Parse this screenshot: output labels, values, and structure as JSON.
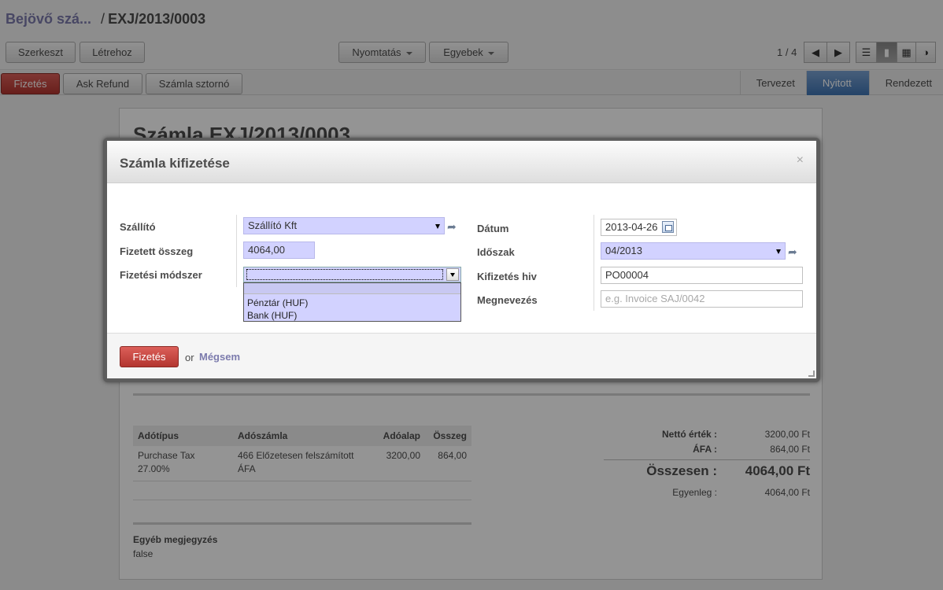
{
  "breadcrumb": {
    "parent": "Bejövő szá...",
    "separator": "/",
    "current": "EXJ/2013/0003"
  },
  "toolbar": {
    "edit": "Szerkeszt",
    "create": "Létrehoz",
    "print": "Nyomtatás",
    "more": "Egyebek"
  },
  "pager": {
    "text": "1 / 4",
    "prev_icon": "arrow-left-icon",
    "next_icon": "arrow-right-icon"
  },
  "view_switcher": {
    "icons": [
      "list-view-icon",
      "form-view-icon",
      "calendar-view-icon",
      "graph-view-icon"
    ],
    "active": "form-view-icon"
  },
  "actions": {
    "pay": "Fizetés",
    "refund": "Ask Refund",
    "cancel_invoice": "Számla sztornó"
  },
  "stages": [
    "Tervezet",
    "Nyitott",
    "Rendezett"
  ],
  "stage_active": "Nyitott",
  "sheet": {
    "title": "Számla EXJ/2013/0003",
    "tax_table": {
      "headers": [
        "Adótípus",
        "Adószámla",
        "Adóalap",
        "Összeg"
      ],
      "rows": [
        [
          "Purchase Tax 27.00%",
          "466 Előzetesen felszámított ÁFA",
          "3200,00",
          "864,00"
        ]
      ]
    },
    "notes_label": "Egyéb megjegyzés",
    "notes_value": "false",
    "totals": {
      "net_label": "Nettó érték :",
      "net_value": "3200,00 Ft",
      "vat_label": "ÁFA :",
      "vat_value": "864,00 Ft",
      "total_label": "Összesen :",
      "total_value": "4064,00 Ft",
      "balance_label": "Egyenleg :",
      "balance_value": "4064,00 Ft"
    }
  },
  "modal": {
    "title": "Számla kifizetése",
    "close": "×",
    "left": {
      "supplier_label": "Szállító",
      "supplier_value": "Szállító Kft",
      "amount_label": "Fizetett összeg",
      "amount_value": "4064,00",
      "method_label": "Fizetési módszer",
      "method_value": "",
      "method_options": [
        "",
        "Pénztár (HUF)",
        "Bank (HUF)"
      ]
    },
    "right": {
      "date_label": "Dátum",
      "date_value": "2013-04-26",
      "period_label": "Időszak",
      "period_value": "04/2013",
      "reference_label": "Kifizetés hiv",
      "reference_value": "PO00004",
      "name_label": "Megnevezés",
      "name_placeholder": "e.g. Invoice SAJ/0042"
    },
    "footer": {
      "pay_button": "Fizetés",
      "or": "or",
      "cancel": "Mégsem"
    }
  },
  "colors": {
    "link": "#7c7bad",
    "primary_button": "#c0392b",
    "required_field": "#d2d2ff",
    "active_stage": "#4a7fbf"
  }
}
